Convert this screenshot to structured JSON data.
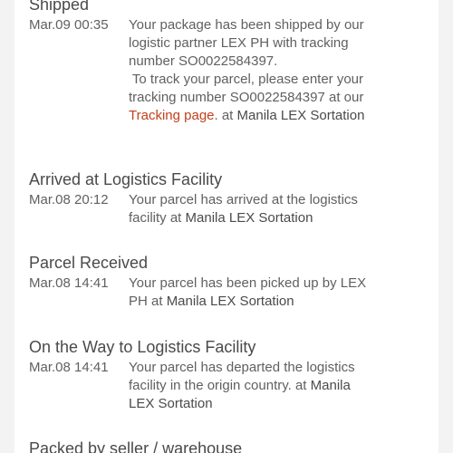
{
  "tracking": {
    "events": [
      {
        "title": "Shipped",
        "time": "Mar.09 00:35",
        "line1": "Your package has been shipped by our",
        "line2": "logistic partner LEX PH with tracking",
        "line3": "number SO0022584397.",
        "line4": " To track your parcel, please enter your",
        "line5": "tracking number SO0022584397 at our",
        "link_text": "Tracking page",
        "after_link": ". at ",
        "location": "Manila LEX Sortation"
      },
      {
        "title": "Arrived at Logistics Facility",
        "time": "Mar.08 20:12",
        "line1": "Your parcel has arrived at the logistics",
        "line2": "facility at ",
        "location": "Manila LEX Sortation"
      },
      {
        "title": "Parcel Received",
        "time": "Mar.08 14:41",
        "line1": "Your parcel has been picked up by LEX",
        "line2": "PH at ",
        "location": "Manila LEX Sortation"
      },
      {
        "title": "On the Way to Logistics Facility",
        "time": "Mar.08 14:41",
        "line1": "Your parcel has departed the logistics",
        "line2": "facility in the origin country. at ",
        "location_part1": "Manila",
        "location_part2": "LEX Sortation"
      },
      {
        "title": "Packed by seller / warehouse"
      }
    ],
    "colors": {
      "link": "#c1401c",
      "text": "#606060",
      "title": "#4a4a4a"
    }
  }
}
